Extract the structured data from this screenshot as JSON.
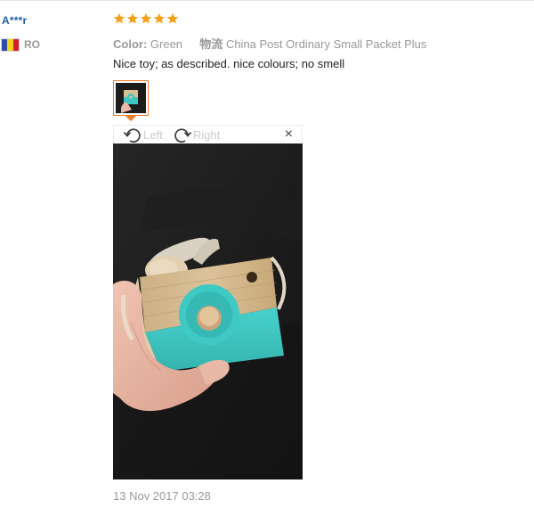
{
  "review": {
    "user": "A***r",
    "country_code": "RO",
    "flag_colors": [
      "#2b4fa8",
      "#f7d117",
      "#d0202d"
    ],
    "rating": 5,
    "star_color": "#f7a21b",
    "color_label": "Color:",
    "color_value": "Green",
    "shipping_label": "物流",
    "shipping_value": "China Post Ordinary Small Packet Plus",
    "text": "Nice toy; as described. nice colours; no smell",
    "date": "13 Nov 2017 03:28"
  },
  "viewer": {
    "rotate_left_label": "Left",
    "rotate_right_label": "Right",
    "close_symbol": "×",
    "accent_color": "#f07c2a"
  },
  "icons": {
    "rotate_left": "rotate-left-icon",
    "rotate_right": "rotate-right-icon",
    "close": "close-icon",
    "star": "star-icon"
  }
}
